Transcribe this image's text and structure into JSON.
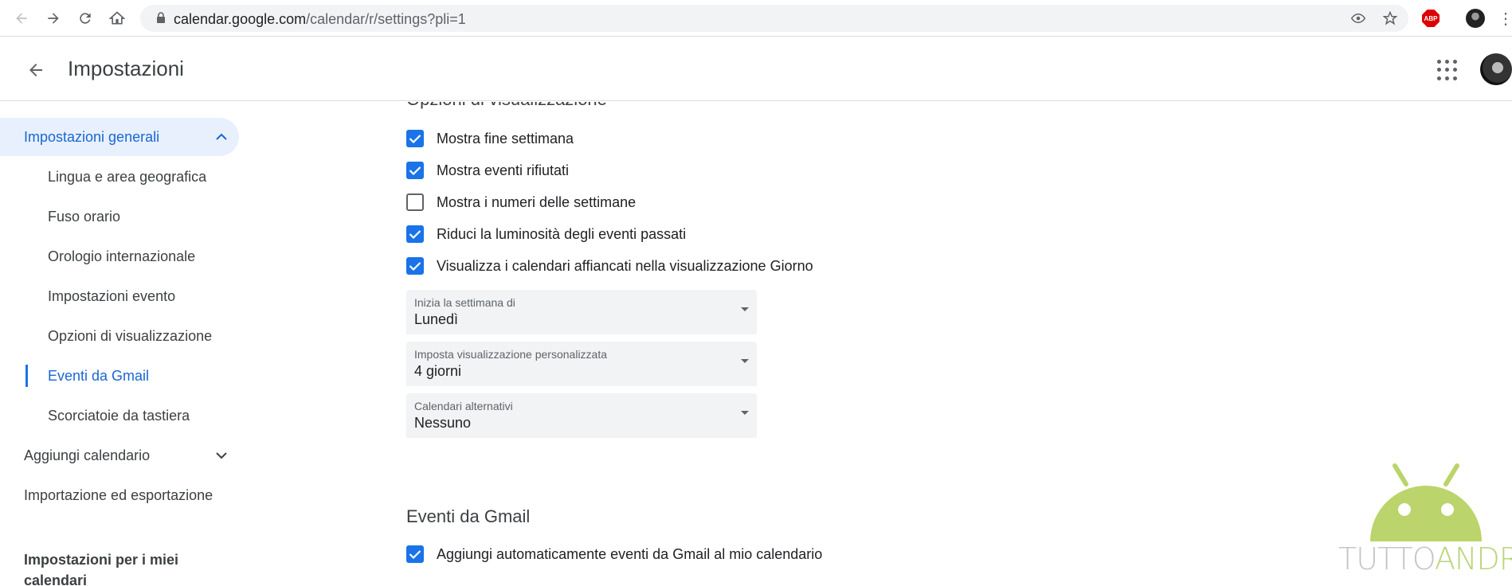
{
  "browser": {
    "url_host": "calendar.google.com",
    "url_path": "/calendar/r/settings?pli=1",
    "abp_label": "ABP"
  },
  "header": {
    "title": "Impostazioni"
  },
  "sidebar": {
    "general": "Impostazioni generali",
    "sub_items": [
      "Lingua e area geografica",
      "Fuso orario",
      "Orologio internazionale",
      "Impostazioni evento",
      "Opzioni di visualizzazione",
      "Eventi da Gmail",
      "Scorciatoie da tastiera"
    ],
    "add_calendar": "Aggiungi calendario",
    "import_export": "Importazione ed esportazione",
    "my_calendars_heading": "Impostazioni per i miei calendari"
  },
  "main": {
    "view_options_heading": "Opzioni di visualizzazione",
    "checkboxes": [
      {
        "label": "Mostra fine settimana",
        "checked": true
      },
      {
        "label": "Mostra eventi rifiutati",
        "checked": true
      },
      {
        "label": "Mostra i numeri delle settimane",
        "checked": false
      },
      {
        "label": "Riduci la luminosità degli eventi passati",
        "checked": true
      },
      {
        "label": "Visualizza i calendari affiancati nella visualizzazione Giorno",
        "checked": true
      }
    ],
    "selects": [
      {
        "label": "Inizia la settimana di",
        "value": "Lunedì"
      },
      {
        "label": "Imposta visualizzazione personalizzata",
        "value": "4 giorni"
      },
      {
        "label": "Calendari alternativi",
        "value": "Nessuno"
      }
    ],
    "gmail_heading": "Eventi da Gmail",
    "gmail_checkbox": {
      "label": "Aggiungi automaticamente eventi da Gmail al mio calendario",
      "checked": true
    }
  },
  "watermark": {
    "text_part1": "TUTTO",
    "text_part2": "ANDROID"
  },
  "colors": {
    "accent": "#1a73e8",
    "active_bg": "#e8f0fe",
    "watermark_green": "#a4c639"
  }
}
